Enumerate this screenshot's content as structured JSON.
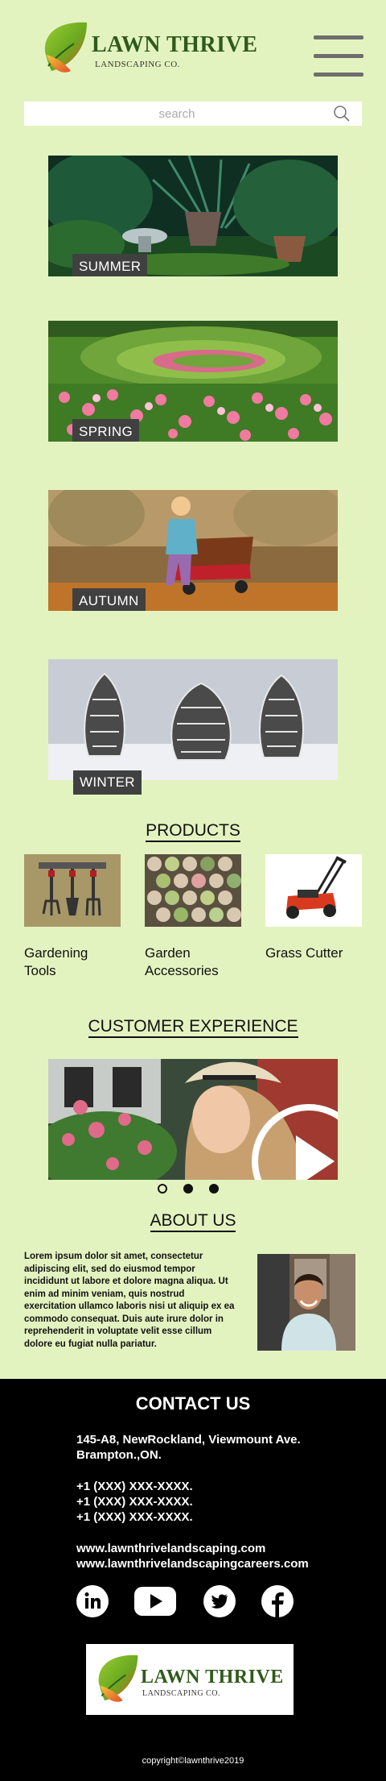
{
  "brand": {
    "name": "LAWN THRIVE",
    "tagline": "LANDSCAPING CO."
  },
  "search": {
    "placeholder": "search",
    "value": ""
  },
  "seasons": [
    {
      "label": "SUMMER"
    },
    {
      "label": "SPRING"
    },
    {
      "label": "AUTUMN"
    },
    {
      "label": "WINTER"
    }
  ],
  "products": {
    "title": "PRODUCTS",
    "items": [
      {
        "line1": "Gardening",
        "line2": "Tools"
      },
      {
        "line1": "Garden",
        "line2": "Accessories"
      },
      {
        "line1": "Grass Cutter",
        "line2": ""
      }
    ]
  },
  "customer_experience": {
    "title": "CUSTOMER EXPERIENCE",
    "slides": 3,
    "active_slide": 1
  },
  "about": {
    "title": "ABOUT US",
    "text": "Lorem ipsum dolor sit amet, consectetur adipiscing elit, sed do eiusmod tempor incididunt ut labore et dolore magna aliqua. Ut enim ad minim veniam, quis nostrud exercitation ullamco laboris nisi ut aliquip ex ea commodo consequat. Duis aute irure dolor in reprehenderit in voluptate velit esse cillum dolore eu fugiat nulla pariatur."
  },
  "contact": {
    "title": "CONTACT US",
    "address_line1": "145-A8, NewRockland, Viewmount Ave.",
    "address_line2": "Brampton.,ON.",
    "phones": [
      "+1 (XXX) XXX-XXXX.",
      "+1 (XXX) XXX-XXXX.",
      "+1 (XXX) XXX-XXXX."
    ],
    "website": "www.lawnthrivelandscaping.com",
    "careers": "www.lawnthrivelandscapingcareers.com",
    "socials": [
      "linkedin-icon",
      "youtube-icon",
      "twitter-icon",
      "facebook-icon"
    ]
  },
  "copyright": "copyright©lawnthrive2019",
  "colors": {
    "background": "#e3f3c0",
    "footer": "#000000",
    "label_bg": "#404040",
    "brand_green": "#2f5a1b"
  }
}
